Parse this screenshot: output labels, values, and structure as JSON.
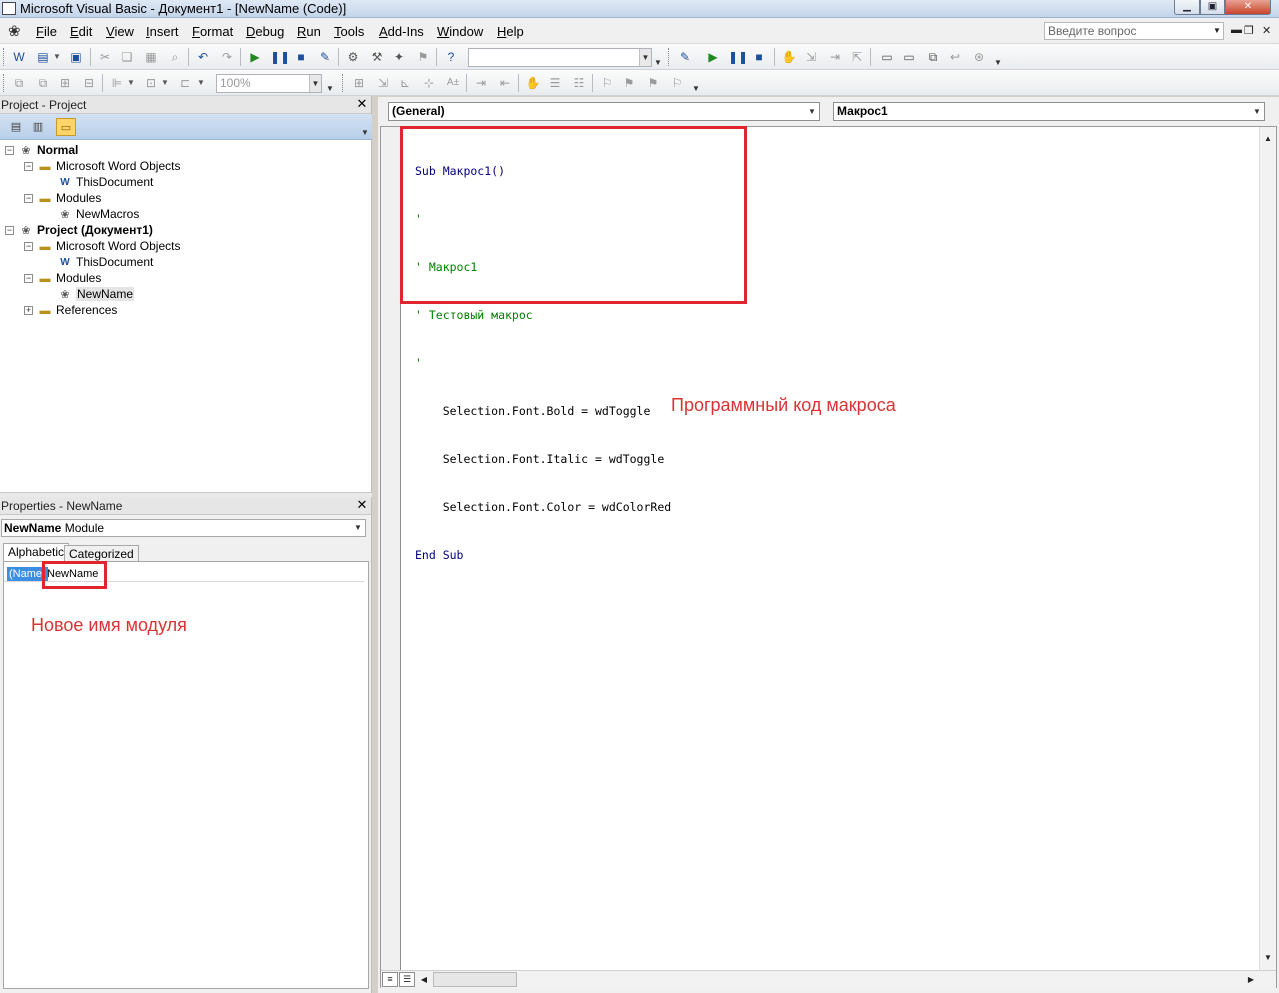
{
  "window": {
    "title": "Microsoft Visual Basic - Документ1 - [NewName (Code)]",
    "min_glyph": "▁",
    "max_glyph": "▣",
    "close_glyph": "✕"
  },
  "menu": {
    "items": [
      {
        "id": "file",
        "accel": "F",
        "rest": "ile"
      },
      {
        "id": "edit",
        "accel": "E",
        "rest": "dit"
      },
      {
        "id": "view",
        "accel": "V",
        "rest": "iew"
      },
      {
        "id": "insert",
        "accel": "I",
        "rest": "nsert"
      },
      {
        "id": "format",
        "accel": "F",
        "rest": "ormat"
      },
      {
        "id": "debug",
        "accel": "D",
        "rest": "ebug"
      },
      {
        "id": "run",
        "accel": "R",
        "rest": "un"
      },
      {
        "id": "tools",
        "accel": "T",
        "rest": "ools"
      },
      {
        "id": "addins",
        "accel": "A",
        "rest": "dd-Ins"
      },
      {
        "id": "window",
        "accel": "W",
        "rest": "indow"
      },
      {
        "id": "help",
        "accel": "H",
        "rest": "elp"
      }
    ],
    "help_placeholder": "Введите вопрос"
  },
  "toolbar": {
    "zoom_value": "100%"
  },
  "project_panel": {
    "title": "Project - Project",
    "tree": [
      {
        "level": 0,
        "toggle": "−",
        "icon": "vba",
        "label": "Normal",
        "bold": true
      },
      {
        "level": 1,
        "toggle": "−",
        "icon": "folder",
        "label": "Microsoft Word Objects"
      },
      {
        "level": 2,
        "toggle": "",
        "icon": "doc",
        "label": "ThisDocument"
      },
      {
        "level": 1,
        "toggle": "−",
        "icon": "folder",
        "label": "Modules"
      },
      {
        "level": 2,
        "toggle": "",
        "icon": "module",
        "label": "NewMacros"
      },
      {
        "level": 0,
        "toggle": "−",
        "icon": "vba",
        "label": "Project (Документ1)",
        "bold": true
      },
      {
        "level": 1,
        "toggle": "−",
        "icon": "folder",
        "label": "Microsoft Word Objects"
      },
      {
        "level": 2,
        "toggle": "",
        "icon": "doc",
        "label": "ThisDocument"
      },
      {
        "level": 1,
        "toggle": "−",
        "icon": "folder",
        "label": "Modules"
      },
      {
        "level": 2,
        "toggle": "",
        "icon": "module",
        "label": "NewName",
        "selected": true
      },
      {
        "level": 1,
        "toggle": "+",
        "icon": "folder",
        "label": "References"
      }
    ]
  },
  "properties_panel": {
    "title": "Properties - NewName",
    "object_name": "NewName",
    "object_type": "Module",
    "tabs": [
      "Alphabetic",
      "Categorized"
    ],
    "property_name": "(Name)",
    "property_value": "NewName",
    "annotation": "Новое имя модуля"
  },
  "code": {
    "object_combo": "(General)",
    "procedure_combo": "Макрос1",
    "lines": [
      {
        "text": "Sub Макрос1()",
        "kind": "code"
      },
      {
        "text": "'",
        "kind": "comment"
      },
      {
        "text": "' Макрос1",
        "kind": "comment"
      },
      {
        "text": "' Тестовый макрос",
        "kind": "comment"
      },
      {
        "text": "'",
        "kind": "comment"
      },
      {
        "text": "    Selection.Font.Bold = wdToggle",
        "kind": "plain"
      },
      {
        "text": "    Selection.Font.Italic = wdToggle",
        "kind": "plain"
      },
      {
        "text": "    Selection.Font.Color = wdColorRed",
        "kind": "plain"
      },
      {
        "text": "End Sub",
        "kind": "code"
      }
    ],
    "annotation": "Программный код макроса"
  },
  "colors": {
    "annotation": "#e0252e",
    "comment": "#008000",
    "keyword": "#00007f",
    "selection": "#3d8ee0"
  }
}
